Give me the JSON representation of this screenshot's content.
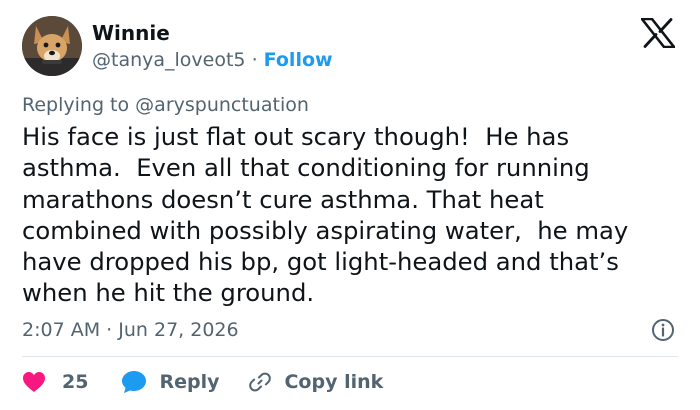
{
  "author": {
    "name": "Winnie",
    "handle": "@tanya_loveot5",
    "separator": "·",
    "follow_label": "Follow",
    "avatar_icon": "dog-avatar"
  },
  "platform": {
    "logo_icon": "x-logo"
  },
  "reply_context": {
    "prefix": "Replying to",
    "mention": "@aryspunctuation"
  },
  "post": {
    "lines": [
      "His face is just flat out scary though!  He has",
      "asthma.  Even all that conditioning for running",
      "marathons doesn’t cure asthma. That heat",
      "combined with possibly aspirating water,  he may",
      "have dropped his bp, got light-headed and that’s",
      "when he hit the ground."
    ]
  },
  "meta": {
    "time": "2:07 AM",
    "separator": "·",
    "date": "Jun 27, 2026",
    "info_icon": "info-icon"
  },
  "actions": {
    "like_count": "25",
    "reply_label": "Reply",
    "copy_label": "Copy link"
  },
  "colors": {
    "accent": "#1d9bf0",
    "like": "#f91880",
    "text": "#0f1419",
    "muted": "#536471",
    "divider": "#e1e8ed"
  }
}
